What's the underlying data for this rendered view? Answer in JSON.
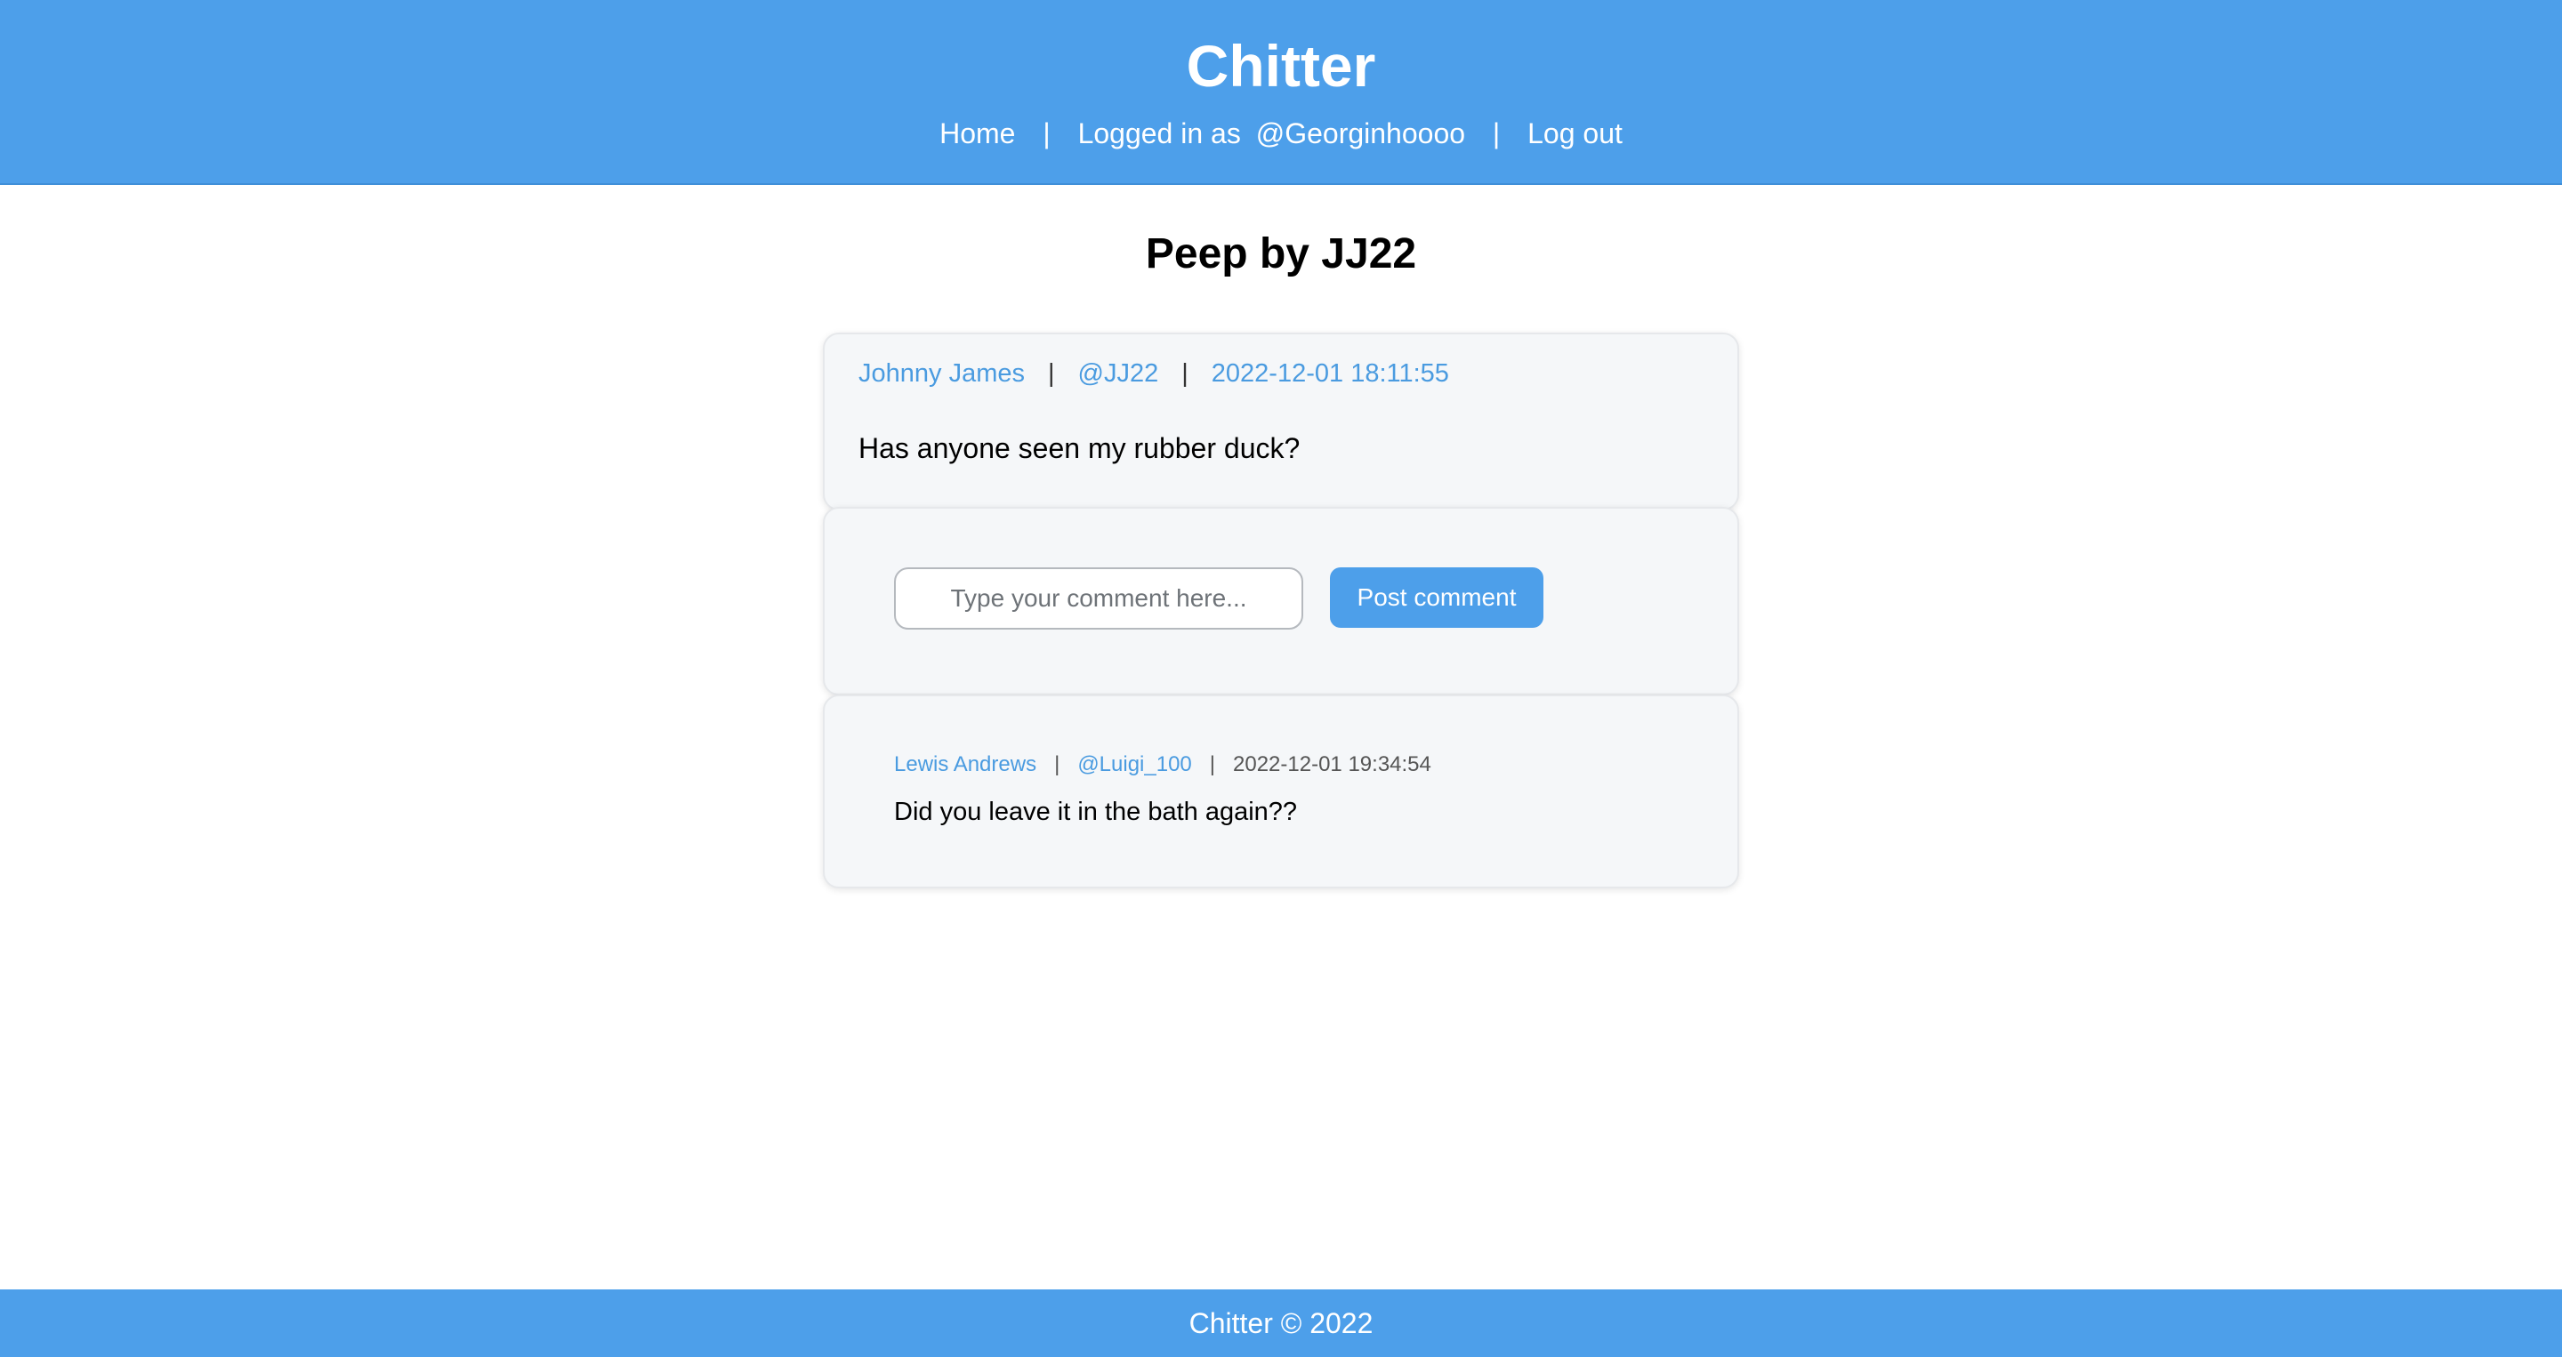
{
  "header": {
    "brand": "Chitter",
    "nav": {
      "home": "Home",
      "separator": "|",
      "logged_in_prefix": "Logged in as",
      "username": "@Georginhoooo",
      "logout": "Log out"
    }
  },
  "page_title": "Peep by JJ22",
  "peep": {
    "author": "Johnny James",
    "handle": "@JJ22",
    "timestamp": "2022-12-01 18:11:55",
    "separator": "|",
    "body": "Has anyone seen my rubber duck?"
  },
  "comment_form": {
    "placeholder": "Type your comment here...",
    "value": "",
    "submit_label": "Post comment"
  },
  "comments": [
    {
      "author": "Lewis Andrews",
      "handle": "@Luigi_100",
      "timestamp": "2022-12-01 19:34:54",
      "separator": "|",
      "body": "Did you leave it in the bath again??"
    }
  ],
  "footer": {
    "text": "Chitter © 2022"
  },
  "colors": {
    "brand": "#4d9fea",
    "link": "#4a9be0",
    "card_bg": "#f5f7f9"
  }
}
